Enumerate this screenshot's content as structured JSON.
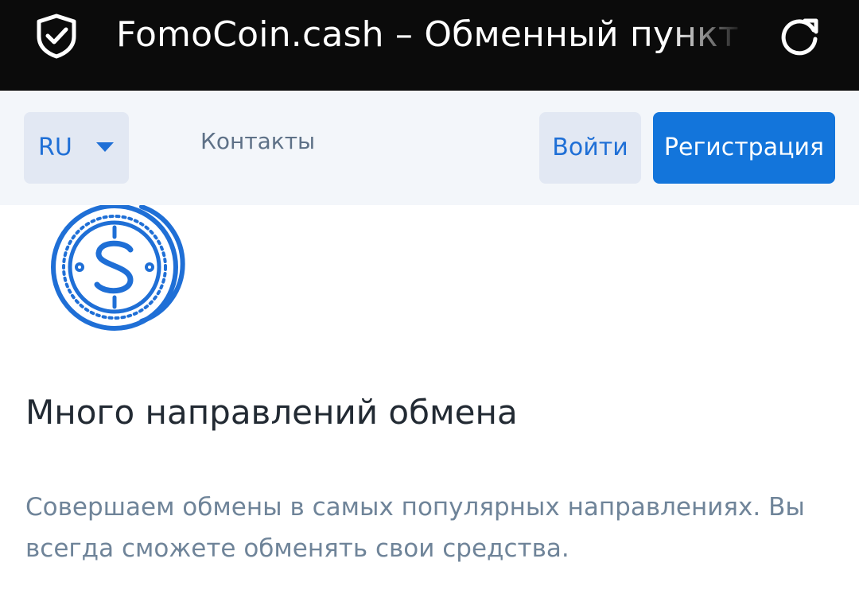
{
  "browser": {
    "page_title": "FomoCoin.cash – Обменный пункт электронных валют",
    "security_icon": "shield-check-icon",
    "reload_icon": "reload-icon"
  },
  "nav": {
    "language": "RU",
    "language_icon": "caret-down-icon",
    "contacts_label": "Контакты",
    "login_label": "Войти",
    "register_label": "Регистрация"
  },
  "feature": {
    "icon": "dollar-coin-icon",
    "title": "Много направлений обмена",
    "description": "Совершаем обмены в самых популярных направлениях. Вы всегда сможете обменять свои средства."
  },
  "colors": {
    "accent": "#1375db",
    "link_blue": "#1f6fd6",
    "nav_bg": "#f3f6fa",
    "button_bg": "#e2e8f3",
    "topbar_bg": "#0b0b0b"
  }
}
